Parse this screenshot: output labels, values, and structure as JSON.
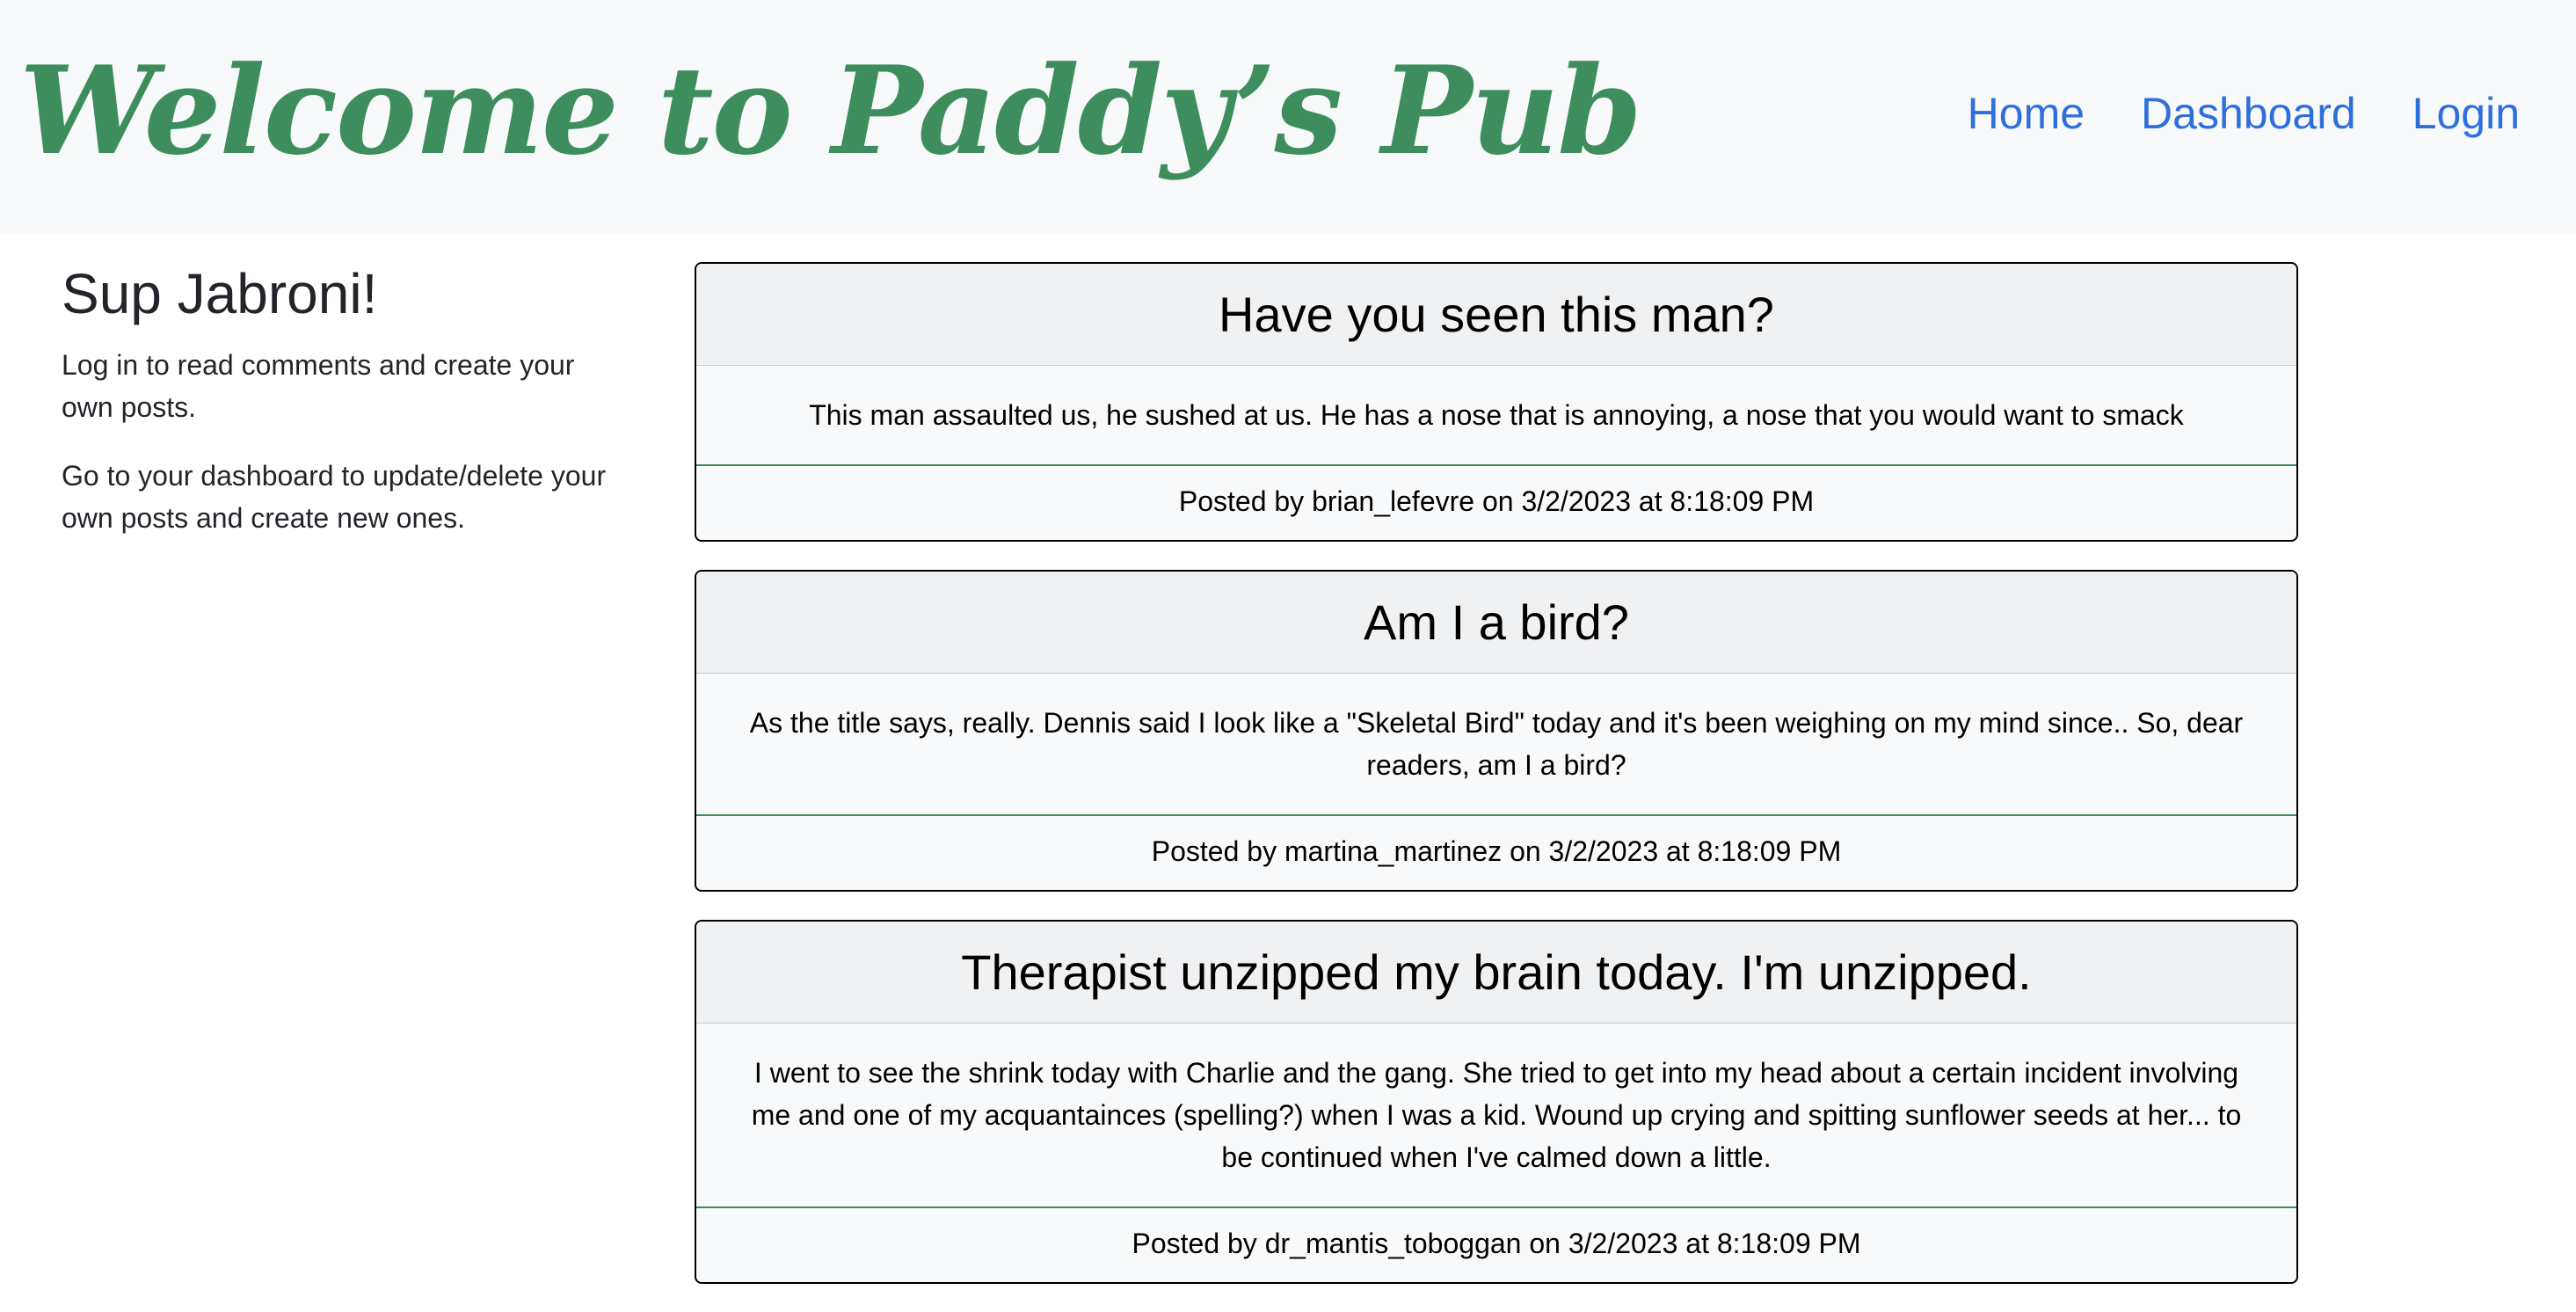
{
  "header": {
    "title": "Welcome to Paddy’s Pub",
    "nav": [
      {
        "label": "Home"
      },
      {
        "label": "Dashboard"
      },
      {
        "label": "Login"
      }
    ]
  },
  "sidebar": {
    "heading": "Sup Jabroni!",
    "paragraphs": [
      "Log in to read comments and create your own posts.",
      "Go to your dashboard to update/delete your own posts and create new ones."
    ]
  },
  "posts": [
    {
      "title": "Have you seen this man?",
      "body": "This man assaulted us, he sushed at us. He has a nose that is annoying, a nose that you would want to smack",
      "footer": "Posted by brian_lefevre on 3/2/2023 at 8:18:09 PM"
    },
    {
      "title": "Am I a bird?",
      "body": "As the title says, really. Dennis said I look like a \"Skeletal Bird\" today and it's been weighing on my mind since.. So, dear readers, am I a bird?",
      "footer": "Posted by martina_martinez on 3/2/2023 at 8:18:09 PM"
    },
    {
      "title": "Therapist unzipped my brain today. I'm unzipped.",
      "body": "I went to see the shrink today with Charlie and the gang. She tried to get into my head about a certain incident involving me and one of my acquantainces (spelling?) when I was a kid. Wound up crying and spitting sunflower seeds at her... to be continued when I've calmed down a little.",
      "footer": "Posted by dr_mantis_toboggan on 3/2/2023 at 8:18:09 PM"
    }
  ],
  "colors": {
    "header_bg": "#f8f9fa",
    "title_green": "#3e8e5d",
    "nav_link": "#2f6fdc",
    "footer_border": "#3e8e5d"
  }
}
